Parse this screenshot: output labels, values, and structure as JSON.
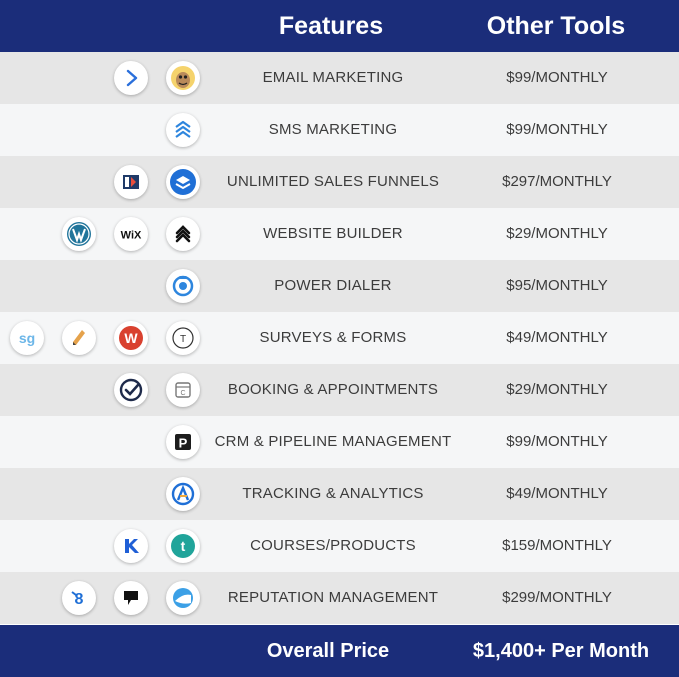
{
  "header": {
    "features": "Features",
    "other_tools": "Other Tools"
  },
  "rows": [
    {
      "feature": "EMAIL MARKETING",
      "price": "$99/MONTHLY",
      "icons": [
        "activecampaign-icon",
        "mailchimp-icon"
      ]
    },
    {
      "feature": "SMS MARKETING",
      "price": "$99/MONTHLY",
      "icons": [
        "stacked-chevrons-icon"
      ]
    },
    {
      "feature": "UNLIMITED SALES FUNNELS",
      "price": "$297/MONTHLY",
      "icons": [
        "clickfunnels-icon",
        "layers-icon"
      ]
    },
    {
      "feature": "WEBSITE BUILDER",
      "price": "$29/MONTHLY",
      "icons": [
        "wordpress-icon",
        "wix-icon",
        "squarespace-icon"
      ]
    },
    {
      "feature": "POWER DIALER",
      "price": "$95/MONTHLY",
      "icons": [
        "dialer-icon"
      ]
    },
    {
      "feature": "SURVEYS & FORMS",
      "price": "$49/MONTHLY",
      "icons": [
        "surveygizmo-icon",
        "pencil-icon",
        "wufoo-icon",
        "typeform-icon"
      ]
    },
    {
      "feature": "BOOKING & APPOINTMENTS",
      "price": "$29/MONTHLY",
      "icons": [
        "check-circle-icon",
        "calendar-icon"
      ]
    },
    {
      "feature": "CRM & PIPELINE MANAGEMENT",
      "price": "$99/MONTHLY",
      "icons": [
        "pipedrive-icon"
      ]
    },
    {
      "feature": "TRACKING & ANALYTICS",
      "price": "$49/MONTHLY",
      "icons": [
        "analytics-icon"
      ]
    },
    {
      "feature": "COURSES/PRODUCTS",
      "price": "$159/MONTHLY",
      "icons": [
        "kajabi-icon",
        "teachable-icon"
      ]
    },
    {
      "feature": "REPUTATION MANAGEMENT",
      "price": "$299/MONTHLY",
      "icons": [
        "birdeye-icon",
        "podium-icon",
        "reputation-icon"
      ]
    }
  ],
  "footer": {
    "label": "Overall Price",
    "total": "$1,400+ Per Month"
  },
  "colors": {
    "header_bg": "#1b2d7a",
    "row_odd": "#e6e6e6",
    "row_even": "#f5f6f7",
    "text": "#3c3c3c"
  }
}
